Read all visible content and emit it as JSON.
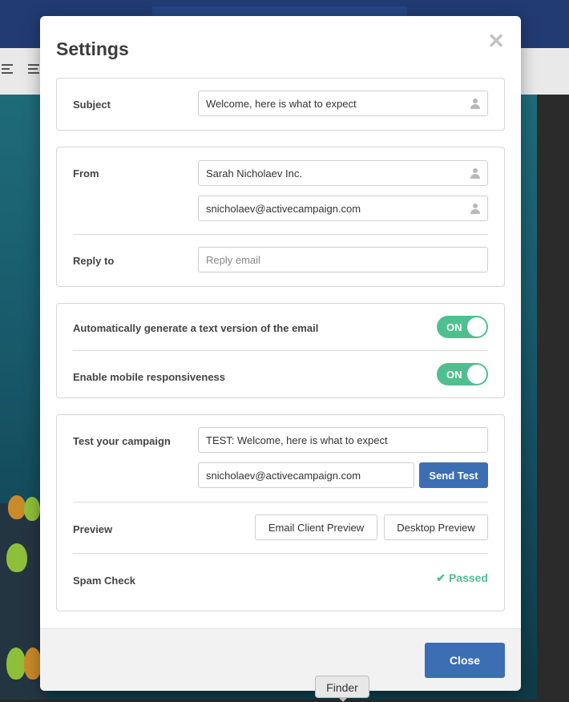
{
  "modal": {
    "title": "Settings",
    "close_icon": "close-icon"
  },
  "subject": {
    "label": "Subject",
    "value": "Welcome, here is what to expect"
  },
  "from": {
    "label": "From",
    "name_value": "Sarah Nicholaev Inc.",
    "email_value": "snicholaev@activecampaign.com"
  },
  "reply_to": {
    "label": "Reply to",
    "placeholder": "Reply email"
  },
  "options": {
    "text_version_label": "Automatically generate a text version of the email",
    "text_version_state": "ON",
    "mobile_label": "Enable mobile responsiveness",
    "mobile_state": "ON"
  },
  "test": {
    "label": "Test your campaign",
    "subject_value": "TEST: Welcome, here is what to expect",
    "email_value": "snicholaev@activecampaign.com",
    "send_label": "Send Test"
  },
  "preview": {
    "label": "Preview",
    "email_client_label": "Email Client Preview",
    "desktop_label": "Desktop Preview"
  },
  "spam": {
    "label": "Spam Check",
    "status": "Passed",
    "status_icon": "checkmark-icon"
  },
  "footer": {
    "close_label": "Close"
  },
  "tooltip": {
    "text": "Finder"
  },
  "colors": {
    "toggle_on": "#4fbf8f",
    "primary_button": "#3c6eb4",
    "passed_text": "#4fbf8f"
  }
}
